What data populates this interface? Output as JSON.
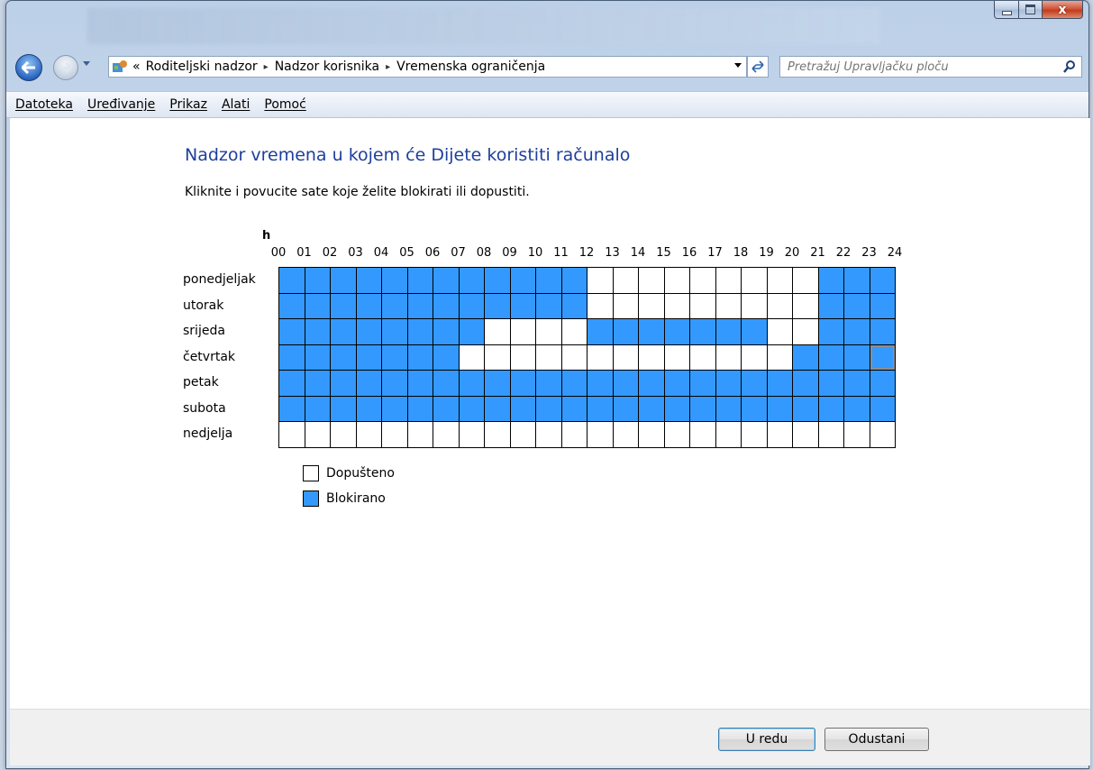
{
  "colors": {
    "blocked": "#3399ff",
    "allowed": "#ffffff",
    "heading": "#1e3f9c"
  },
  "window": {
    "close_glyph": "x"
  },
  "nav": {
    "breadcrumb_overflow": "«",
    "breadcrumbs": [
      "Roditeljski nadzor",
      "Nadzor korisnika",
      "Vremenska ograničenja"
    ],
    "breadcrumb_separator": "▸",
    "search_placeholder": "Pretražuj Upravljačku ploču"
  },
  "menu": [
    "Datoteka",
    "Uređivanje",
    "Prikaz",
    "Alati",
    "Pomoć"
  ],
  "main": {
    "title": "Nadzor vremena u kojem će Dijete koristiti računalo",
    "instructions": "Kliknite i povucite sate koje želite blokirati ili dopustiti.",
    "hours_unit": "h",
    "hours": [
      "00",
      "01",
      "02",
      "03",
      "04",
      "05",
      "06",
      "07",
      "08",
      "09",
      "10",
      "11",
      "12",
      "13",
      "14",
      "15",
      "16",
      "17",
      "18",
      "19",
      "20",
      "21",
      "22",
      "23",
      "24"
    ],
    "days": [
      "ponedjeljak",
      "utorak",
      "srijeda",
      "četvrtak",
      "petak",
      "subota",
      "nedjelja"
    ],
    "schedule": [
      [
        1,
        1,
        1,
        1,
        1,
        1,
        1,
        1,
        1,
        1,
        1,
        1,
        0,
        0,
        0,
        0,
        0,
        0,
        0,
        0,
        0,
        1,
        1,
        1
      ],
      [
        1,
        1,
        1,
        1,
        1,
        1,
        1,
        1,
        1,
        1,
        1,
        1,
        0,
        0,
        0,
        0,
        0,
        0,
        0,
        0,
        0,
        1,
        1,
        1
      ],
      [
        1,
        1,
        1,
        1,
        1,
        1,
        1,
        1,
        0,
        0,
        0,
        0,
        1,
        1,
        1,
        1,
        1,
        1,
        1,
        0,
        0,
        1,
        1,
        1
      ],
      [
        1,
        1,
        1,
        1,
        1,
        1,
        1,
        0,
        0,
        0,
        0,
        0,
        0,
        0,
        0,
        0,
        0,
        0,
        0,
        0,
        1,
        1,
        1,
        1
      ],
      [
        1,
        1,
        1,
        1,
        1,
        1,
        1,
        1,
        1,
        1,
        1,
        1,
        1,
        1,
        1,
        1,
        1,
        1,
        1,
        1,
        1,
        1,
        1,
        1
      ],
      [
        1,
        1,
        1,
        1,
        1,
        1,
        1,
        1,
        1,
        1,
        1,
        1,
        1,
        1,
        1,
        1,
        1,
        1,
        1,
        1,
        1,
        1,
        1,
        1
      ],
      [
        0,
        0,
        0,
        0,
        0,
        0,
        0,
        0,
        0,
        0,
        0,
        0,
        0,
        0,
        0,
        0,
        0,
        0,
        0,
        0,
        0,
        0,
        0,
        0
      ]
    ],
    "legend": {
      "allowed": "Dopušteno",
      "blocked": "Blokirano"
    }
  },
  "footer": {
    "ok_label": "U redu",
    "cancel_label": "Odustani"
  }
}
